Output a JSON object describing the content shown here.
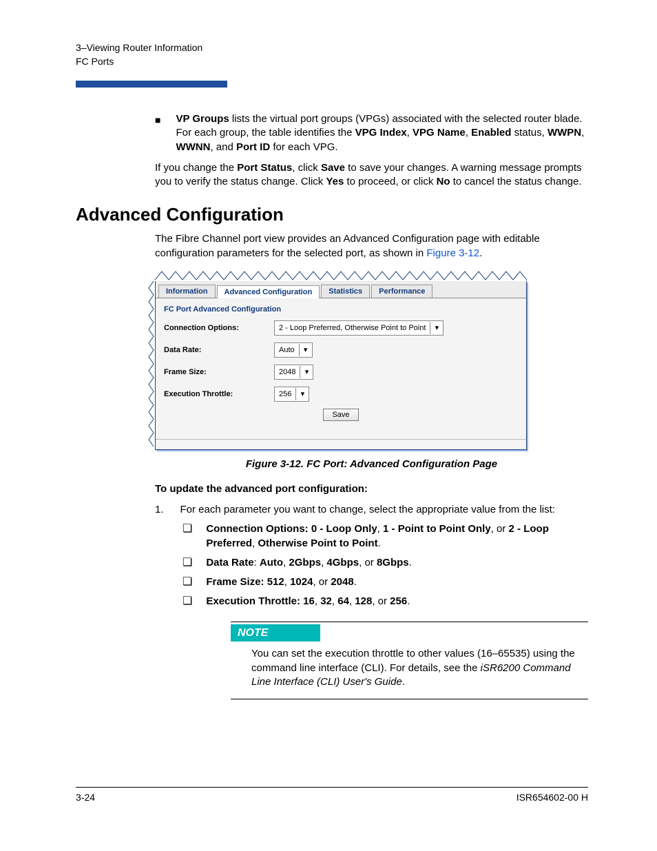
{
  "header": {
    "line1": "3–Viewing Router Information",
    "line2": "FC Ports"
  },
  "vp_groups": {
    "lead": "VP Groups",
    "text1": " lists the virtual port groups (VPGs) associated with the selected router blade. For each group, the table identifies the ",
    "b1": "VPG Index",
    "b2": "VPG Name",
    "b3": "Enabled",
    "mid": " status, ",
    "b4": "WWPN",
    "b5": "WWNN",
    "and": ", and ",
    "b6": "Port ID",
    "tail": " for each VPG."
  },
  "port_status_para": {
    "p1": "If you change the ",
    "b1": "Port Status",
    "p2": ", click ",
    "b2": "Save",
    "p3": " to save your changes. A warning message prompts you to verify the status change. Click ",
    "b3": "Yes",
    "p4": " to proceed, or click ",
    "b4": "No",
    "p5": " to cancel the status change."
  },
  "section_title": "Advanced Configuration",
  "adv_para": {
    "p1": "The Fibre Channel port view provides an Advanced Configuration page with editable configuration parameters for the selected port, as shown in ",
    "link": "Figure 3-12",
    "p2": "."
  },
  "figure": {
    "tabs": [
      "Information",
      "Advanced Configuration",
      "Statistics",
      "Performance"
    ],
    "active_tab": 1,
    "fieldset": "FC Port Advanced Configuration",
    "rows": [
      {
        "label": "Connection Options:",
        "value": "2 - Loop Preferred, Otherwise Point to Point"
      },
      {
        "label": "Data Rate:",
        "value": "Auto"
      },
      {
        "label": "Frame Size:",
        "value": "2048"
      },
      {
        "label": "Execution Throttle:",
        "value": "256"
      }
    ],
    "save": "Save",
    "caption": "Figure 3-12. FC Port: Advanced Configuration Page"
  },
  "procedure": {
    "heading": "To update the advanced port configuration:",
    "step_num": "1.",
    "step_text": "For each parameter you want to change, select the appropriate value from the list:",
    "items": [
      {
        "b": "Connection Options: 0 - Loop Only",
        "mid": ", ",
        "b2": "1 - Point to Point Only",
        "mid2": ", or ",
        "b3": "2 - Loop Preferred",
        "mid3": ", ",
        "b4": "Otherwise Point to Point",
        "tail": "."
      },
      {
        "b": "Data Rate",
        "mid": ": ",
        "b2": "Auto",
        "mid2": ", ",
        "b3": "2Gbps",
        "mid3": ", ",
        "b4": "4Gbps",
        "mid4": ", or ",
        "b5": "8Gbps",
        "tail": "."
      },
      {
        "b": "Frame Size: 512",
        "mid": ", ",
        "b2": "1024",
        "mid2": ", or ",
        "b3": "2048",
        "tail": "."
      },
      {
        "b": "Execution Throttle: 16",
        "mid": ", ",
        "b2": "32",
        "mid2": ", ",
        "b3": "64",
        "mid3": ", ",
        "b4": "128",
        "mid4": ", or ",
        "b5": "256",
        "tail": "."
      }
    ]
  },
  "note": {
    "title": "NOTE",
    "text1": "You can set the execution throttle to other values (16–65535) using the command line interface (CLI). For details, see the ",
    "italic": "iSR6200 Command Line Interface (CLI) User's Guide",
    "text2": "."
  },
  "footer": {
    "left": "3-24",
    "right": "ISR654602-00  H"
  }
}
